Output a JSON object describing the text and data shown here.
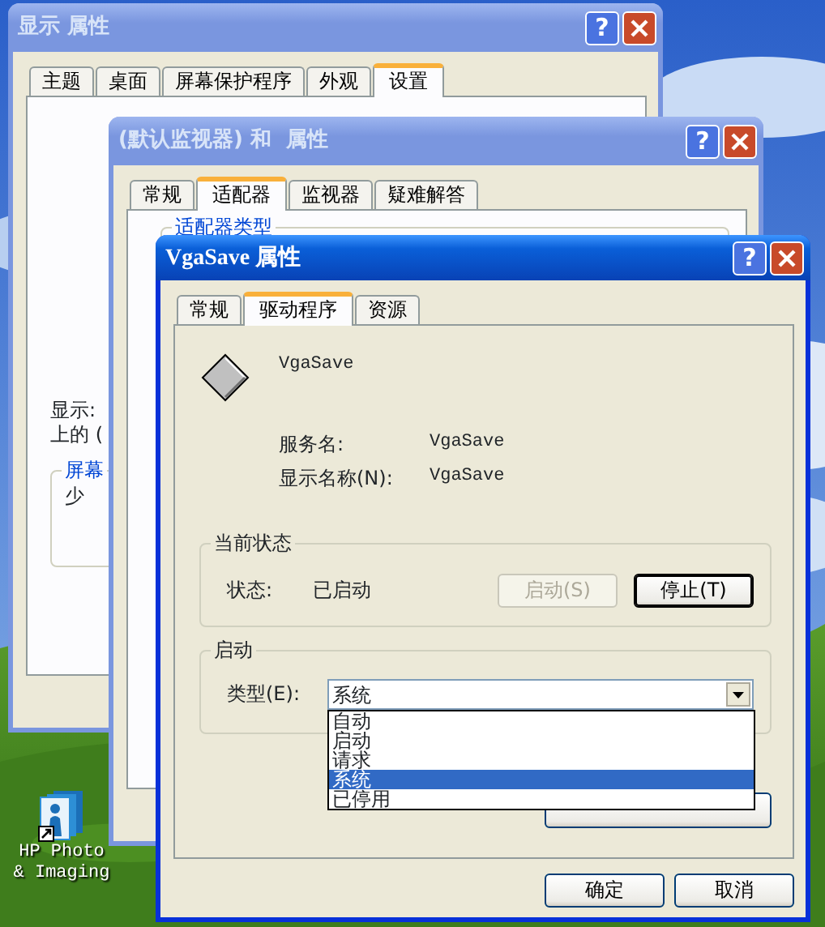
{
  "desktop_icons": [
    {
      "label": "HP Photo & Imaging"
    }
  ],
  "display_window": {
    "title": "显示 属性",
    "active": false,
    "help": "?",
    "tabs": [
      {
        "label": "主题",
        "selected": false
      },
      {
        "label": "桌面",
        "selected": false
      },
      {
        "label": "屏幕保护程序",
        "selected": false
      },
      {
        "label": "外观",
        "selected": false
      },
      {
        "label": "设置",
        "selected": true
      }
    ],
    "lines": [
      "显示:",
      "上的 ("
    ],
    "group_label": "屏幕",
    "group_text": "少"
  },
  "monitor_window": {
    "title": "(默认监视器) 和  属性",
    "active": false,
    "help": "?",
    "tabs": [
      {
        "label": "常规",
        "selected": false
      },
      {
        "label": "适配器",
        "selected": true
      },
      {
        "label": "监视器",
        "selected": false
      },
      {
        "label": "疑难解答",
        "selected": false
      }
    ],
    "group_label": "适配器类型"
  },
  "driver_window": {
    "title": "VgaSave 属性",
    "active": true,
    "help": "?",
    "tabs": [
      {
        "label": "常规",
        "selected": false
      },
      {
        "label": "驱动程序",
        "selected": true
      },
      {
        "label": "资源",
        "selected": false
      }
    ],
    "driver_name": "VgaSave",
    "fields": [
      {
        "label": "服务名:",
        "value": "VgaSave"
      },
      {
        "label": "显示名称(N):",
        "value": "VgaSave"
      }
    ],
    "status_group": {
      "title": "当前状态",
      "label": "状态:",
      "value": "已启动",
      "buttons": [
        {
          "label": "启动(S)",
          "disabled": true,
          "default": false
        },
        {
          "label": "停止(T)",
          "disabled": false,
          "default": true
        }
      ]
    },
    "startup_group": {
      "title": "启动",
      "label": "类型(E):",
      "value": "系统",
      "expanded": true,
      "options": [
        {
          "label": "自动",
          "selected": false
        },
        {
          "label": "启动",
          "selected": false
        },
        {
          "label": "请求",
          "selected": false
        },
        {
          "label": "系统",
          "selected": true
        },
        {
          "label": "已停用",
          "selected": false
        }
      ]
    },
    "buttons": [
      "确定",
      "取消"
    ]
  }
}
